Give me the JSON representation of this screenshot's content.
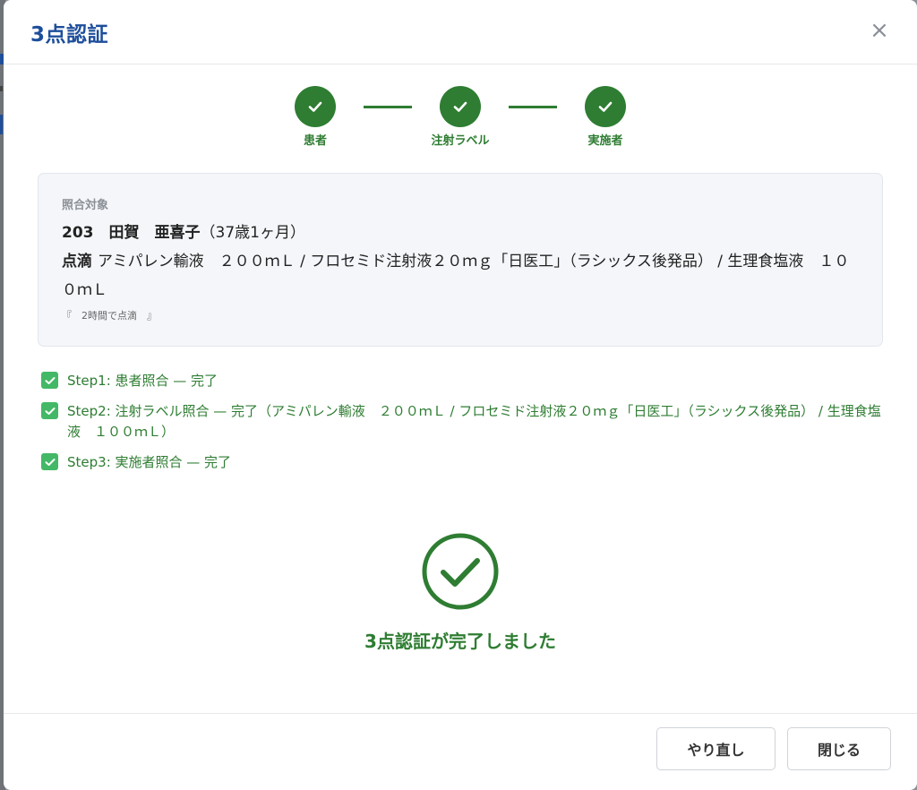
{
  "modal": {
    "title": "3点認証",
    "close_glyph": "×"
  },
  "stepper": {
    "steps": [
      {
        "label": "患者",
        "status": "complete"
      },
      {
        "label": "注射ラベル",
        "status": "complete"
      },
      {
        "label": "実施者",
        "status": "complete"
      }
    ]
  },
  "target": {
    "heading": "照合対象",
    "patient_id_name": "203　田賀　亜喜子",
    "patient_age": "（37歳1ヶ月）",
    "drip_label": "点滴",
    "drip_text": "アミパレン輸液　２００ｍＬ / フロセミド注射液２０ｍｇ「日医工」（ラシックス後発品） / 生理食塩液　１００ｍＬ",
    "note": "『　2時間で点滴　』"
  },
  "checklist": [
    {
      "text": "Step1: 患者照合 — 完了",
      "checked": true
    },
    {
      "text": "Step2: 注射ラベル照合 — 完了（アミパレン輸液　２００ｍＬ / フロセミド注射液２０ｍｇ「日医工」（ラシックス後発品） / 生理食塩液　１００ｍＬ）",
      "checked": true
    },
    {
      "text": "Step3: 実施者照合 — 完了",
      "checked": true
    }
  ],
  "completion": {
    "message": "3点認証が完了しました"
  },
  "footer": {
    "redo_label": "やり直し",
    "close_label": "閉じる"
  },
  "colors": {
    "title_blue": "#1d4e9b",
    "success_green": "#2e7d32",
    "checkbox_green": "#43b866"
  },
  "icons": {
    "close": "close-icon",
    "step_check": "check-icon",
    "checkbox": "checkbox-checked-icon",
    "done": "check-circle-icon"
  }
}
